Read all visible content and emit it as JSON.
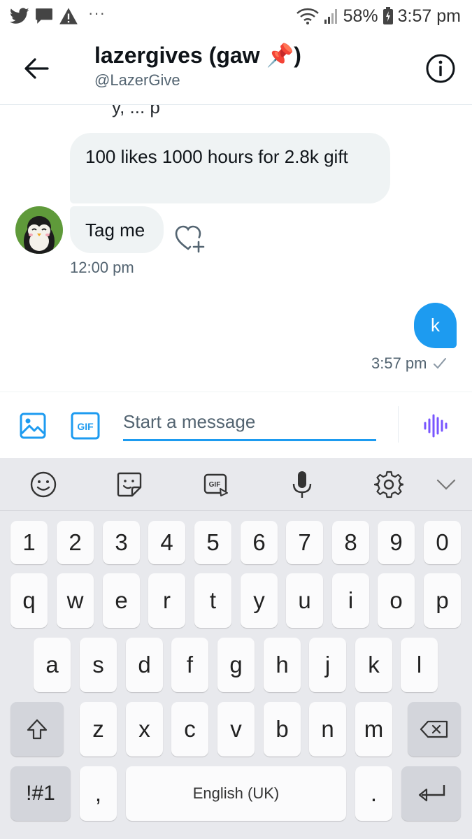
{
  "status_bar": {
    "battery": "58%",
    "time": "3:57 pm",
    "notification_icons": [
      "twitter-icon",
      "message-icon",
      "warning-icon"
    ],
    "more": "···"
  },
  "header": {
    "contact_name": "lazergives (gaw 📌)",
    "contact_handle": "@LazerGive"
  },
  "conversation": {
    "cut_off_text": "y, ... p",
    "incoming": [
      {
        "text": "100 likes 1000 hours for 2.8k gift"
      },
      {
        "text": "Tag me"
      }
    ],
    "incoming_time": "12:00 pm",
    "outgoing": [
      {
        "text": "k"
      }
    ],
    "outgoing_time": "3:57 pm",
    "outgoing_status": "sent"
  },
  "composer": {
    "placeholder": "Start a message",
    "gif_label": "GIF"
  },
  "keyboard": {
    "toolbar_gif_label": "GIF",
    "number_row": [
      "1",
      "2",
      "3",
      "4",
      "5",
      "6",
      "7",
      "8",
      "9",
      "0"
    ],
    "row1": [
      "q",
      "w",
      "e",
      "r",
      "t",
      "y",
      "u",
      "i",
      "o",
      "p"
    ],
    "row2": [
      "a",
      "s",
      "d",
      "f",
      "g",
      "h",
      "j",
      "k",
      "l"
    ],
    "row3": [
      "z",
      "x",
      "c",
      "v",
      "b",
      "n",
      "m"
    ],
    "symbols_key": "!#1",
    "comma_key": ",",
    "space_label": "English (UK)",
    "period_key": "."
  },
  "colors": {
    "accent": "#1d9bf0",
    "bubble_incoming": "#eff3f4",
    "voice_icon": "#7856ff",
    "keyboard_bg": "#e8e9ed"
  }
}
